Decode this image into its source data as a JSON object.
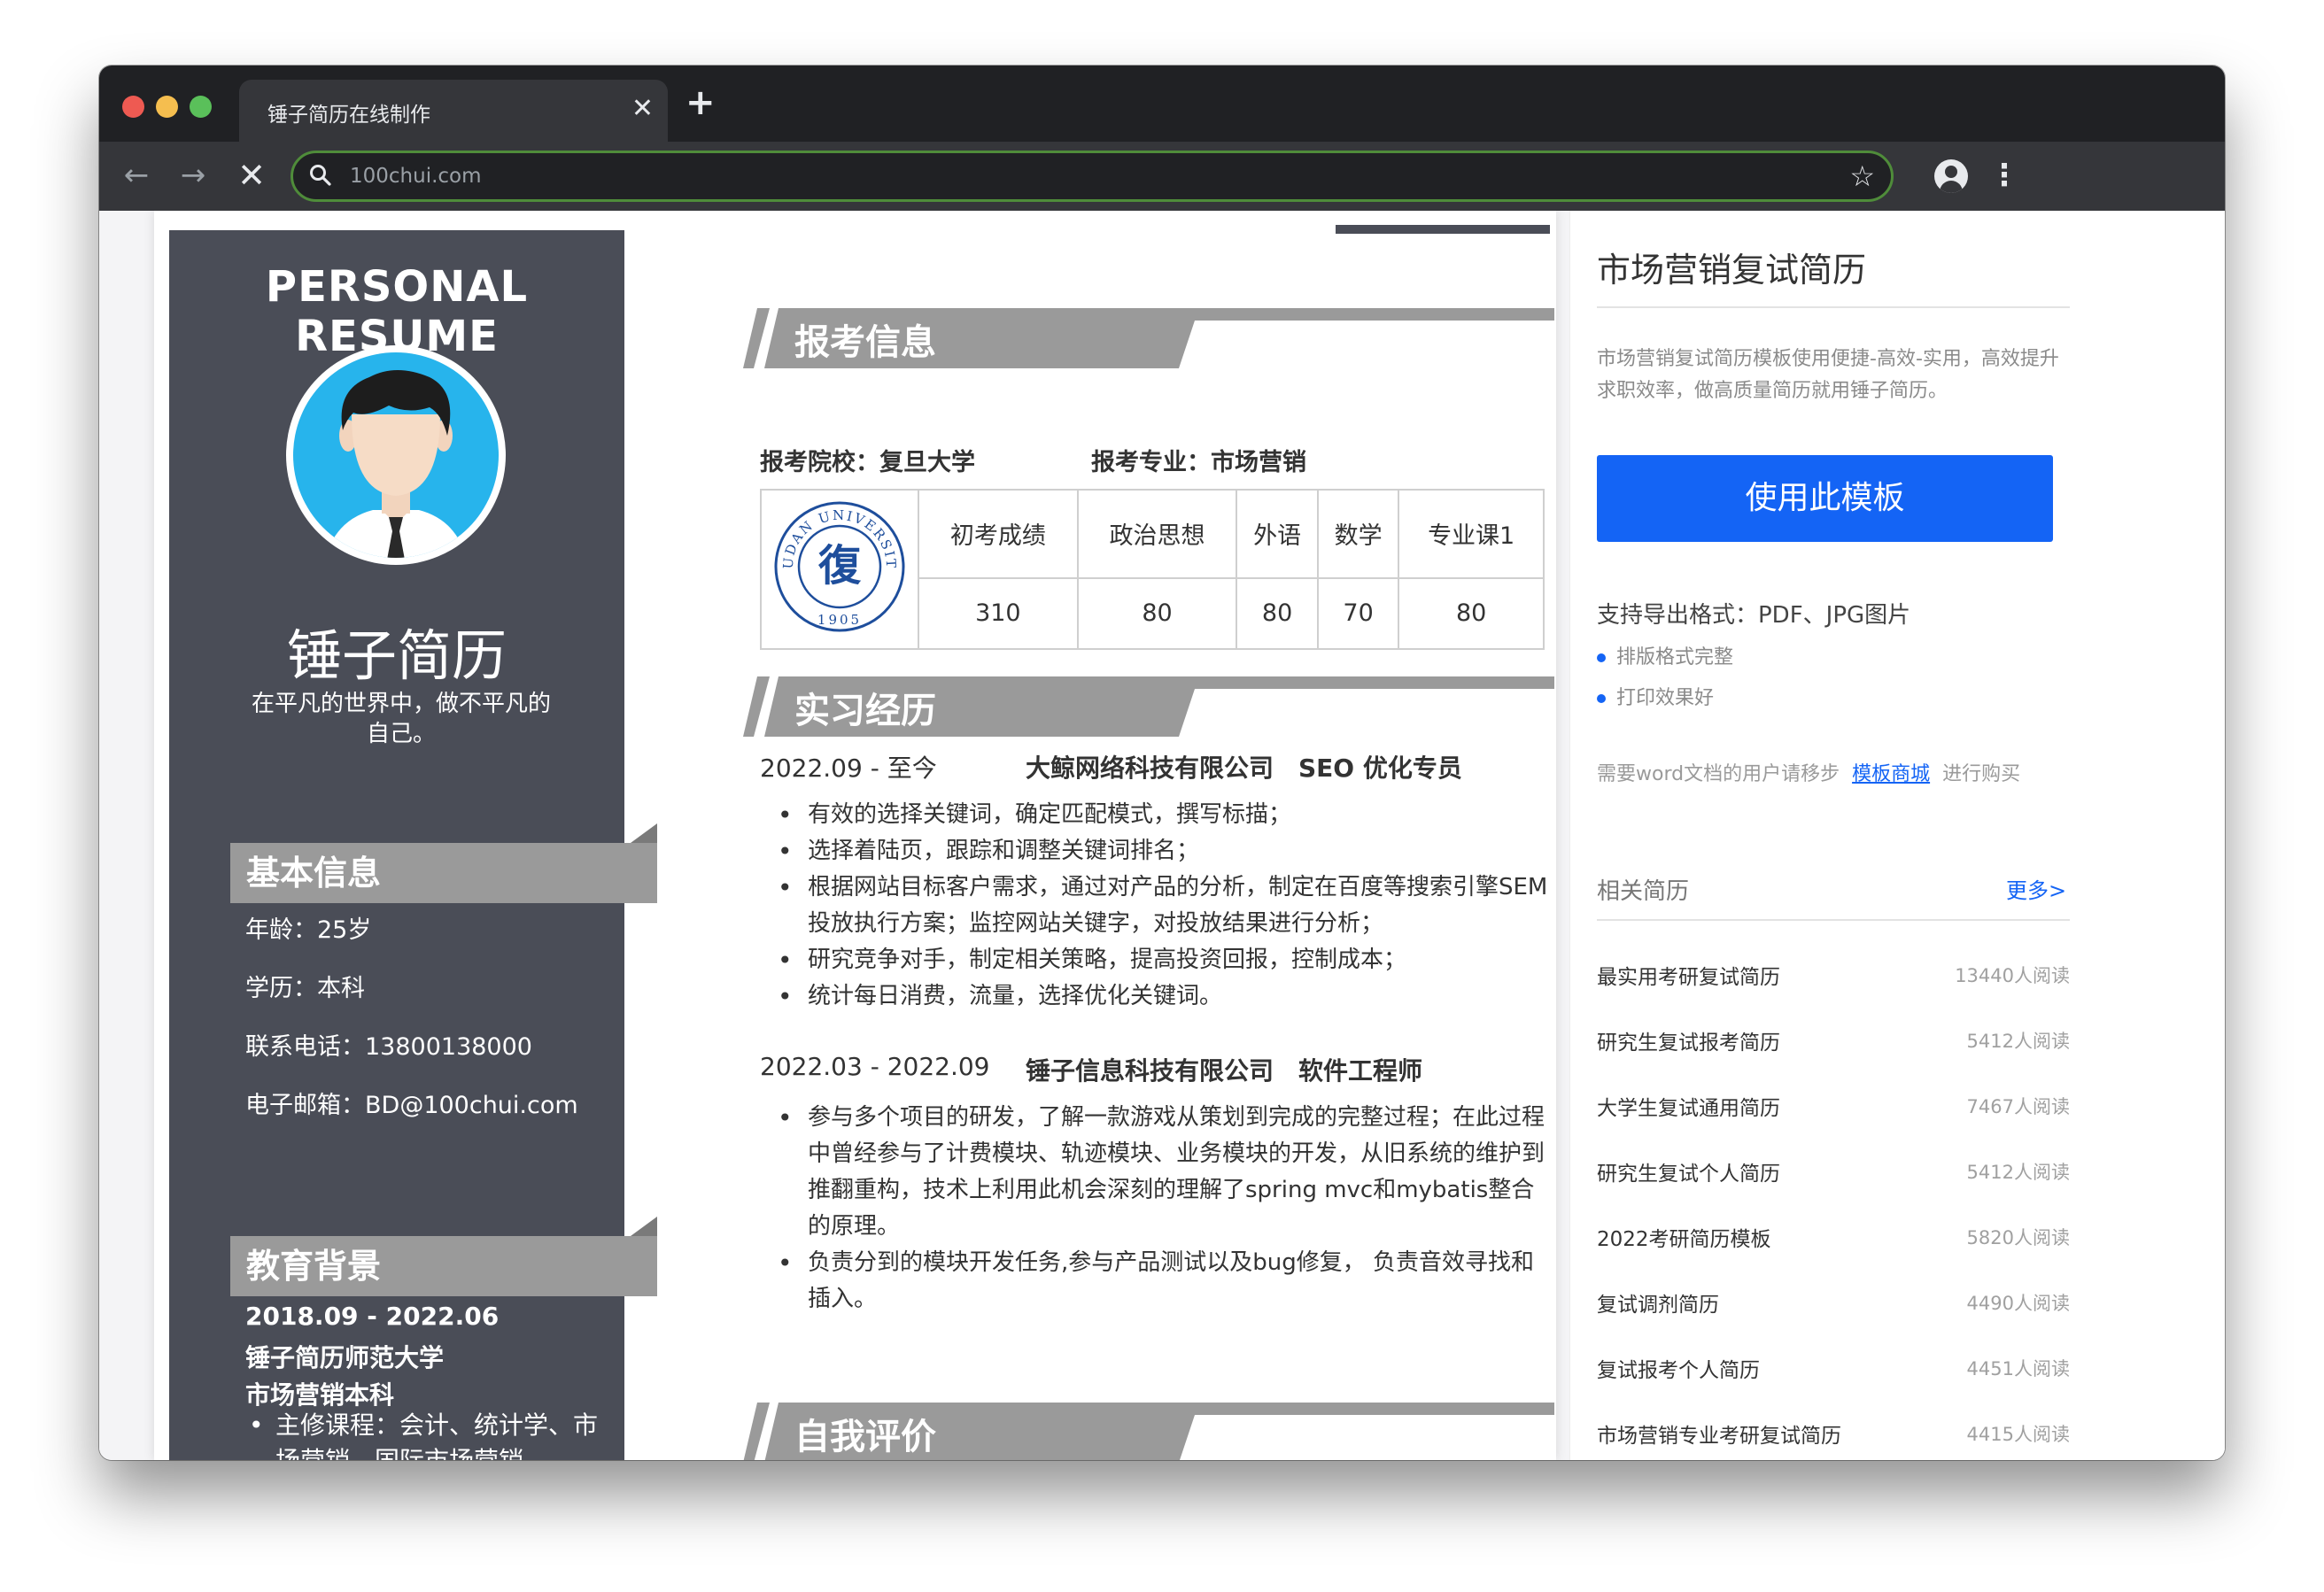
{
  "browser": {
    "tab_title": "锤子简历在线制作",
    "url": "100chui.com",
    "close_glyph": "✕",
    "new_tab_glyph": "+",
    "back_glyph": "←",
    "forward_glyph": "→",
    "stop_glyph": "✕",
    "star_glyph": "☆",
    "menu_glyph": "⋮"
  },
  "resume": {
    "title": "PERSONAL RESUME",
    "name": "锤子简历",
    "motto": "在平凡的世界中，做不平凡的自己。",
    "basic": {
      "heading": "基本信息",
      "lines": [
        "年龄：25岁",
        "学历：本科",
        "联系电话：13800138000",
        "电子邮箱：BD@100chui.com"
      ]
    },
    "education": {
      "heading": "教育背景",
      "date": "2018.09 - 2022.06",
      "school": "锤子简历师范大学",
      "major": "市场营销本科",
      "bullet": "主修课程：会计、统计学、市场营销、国际市场营销"
    },
    "exam": {
      "heading": "报考信息",
      "school_line": "报考院校：复旦大学",
      "major_line": "报考专业：市场营销",
      "logo_text": "FUDAN UNIVERSITY",
      "logo_year": "1905",
      "logo_char": "復",
      "columns": [
        "初考成绩",
        "政治思想",
        "外语",
        "数学",
        "专业课1"
      ],
      "scores": [
        "310",
        "80",
        "80",
        "70",
        "80"
      ]
    },
    "internship": {
      "heading": "实习经历",
      "jobs": [
        {
          "date": "2022.09 - 至今",
          "company": "大鲸网络科技有限公司　SEO 优化专员",
          "items": [
            "有效的选择关键词，确定匹配模式，撰写标描；",
            "选择着陆页，跟踪和调整关键词排名；",
            "根据网站目标客户需求，通过对产品的分析，制定在百度等搜索引擎SEM投放执行方案；监控网站关键字，对投放结果进行分析；",
            "研究竞争对手，制定相关策略，提高投资回报，控制成本；",
            "统计每日消费，流量，选择优化关键词。"
          ]
        },
        {
          "date": "2022.03 - 2022.09",
          "company": "锤子信息科技有限公司　软件工程师",
          "items": [
            "参与多个项目的研发，了解一款游戏从策划到完成的完整过程；在此过程中曾经参与了计费模块、轨迹模块、业务模块的开发，从旧系统的维护到推翻重构，技术上利用此机会深刻的理解了spring mvc和mybatis整合的原理。",
            "负责分到的模块开发任务,参与产品测试以及bug修复， 负责音效寻找和插入。"
          ]
        }
      ]
    },
    "self_eval": {
      "heading": "自我评价"
    }
  },
  "sidebar": {
    "title": "市场营销复试简历",
    "description": "市场营销复试简历模板使用便捷-高效-实用，高效提升求职效率，做高质量简历就用锤子简历。",
    "use_button": "使用此模板",
    "export": "支持导出格式：PDF、JPG图片",
    "features": [
      "排版格式完整",
      "打印效果好"
    ],
    "word_prefix": "需要word文档的用户请移步",
    "word_link": "模板商城",
    "word_suffix": "进行购买",
    "related_title": "相关简历",
    "more": "更多>",
    "related": [
      {
        "title": "最实用考研复试简历",
        "reads": "13440人阅读"
      },
      {
        "title": "研究生复试报考简历",
        "reads": "5412人阅读"
      },
      {
        "title": "大学生复试通用简历",
        "reads": "7467人阅读"
      },
      {
        "title": "研究生复试个人简历",
        "reads": "5412人阅读"
      },
      {
        "title": "2022考研简历模板",
        "reads": "5820人阅读"
      },
      {
        "title": "复试调剂简历",
        "reads": "4490人阅读"
      },
      {
        "title": "复试报考个人简历",
        "reads": "4451人阅读"
      },
      {
        "title": "市场营销专业考研复试简历",
        "reads": "4415人阅读"
      }
    ]
  },
  "colors": {
    "accent": "#1464f5",
    "resume_dark": "#4a4d57",
    "section_gray": "#9a9a9a",
    "logo_blue": "#1e4e9c"
  }
}
